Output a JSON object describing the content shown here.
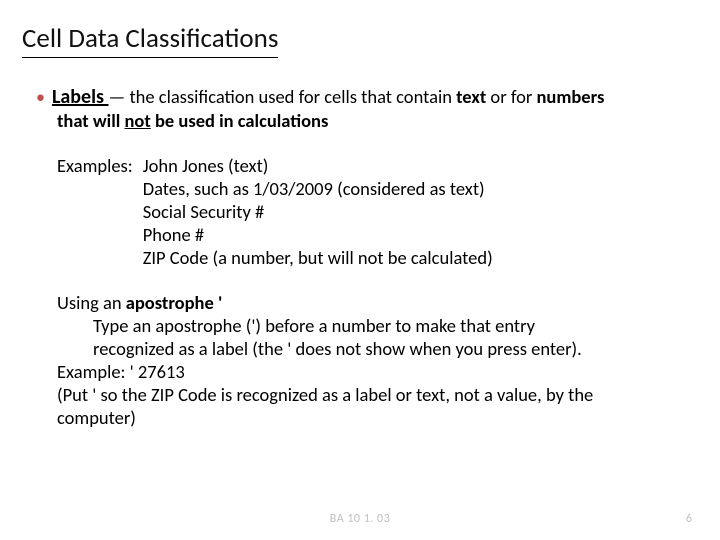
{
  "title": "Cell Data Classifications",
  "bullet": {
    "term": "Labels ",
    "def_pre": "— the classification used for cells that contain ",
    "def_text": "text",
    "def_mid": " or for ",
    "def_numbers": "numbers",
    "def_post": " ",
    "cont_pre": "that will ",
    "cont_not": "not",
    "cont_post": " be used in calculations"
  },
  "examples": {
    "label": "Examples:",
    "items": [
      "John Jones (text)",
      "Dates, such as 1/03/2009 (considered as text)",
      "Social Security #",
      "Phone #",
      "ZIP Code (a number, but will not be calculated)"
    ]
  },
  "apostrophe": {
    "heading_pre": "Using an ",
    "heading_b": "apostrophe '",
    "line1": "Type an apostrophe (') before a number to make that entry",
    "line2": "recognized as a label (the ' does not show when you press enter).",
    "example": "Example:  ' 27613",
    "note1": "(Put ' so the ZIP Code is recognized as a label or text,  not a value, by the",
    "note2": "computer)"
  },
  "footer": {
    "center": "BA 10  1. 03",
    "page": "6"
  }
}
